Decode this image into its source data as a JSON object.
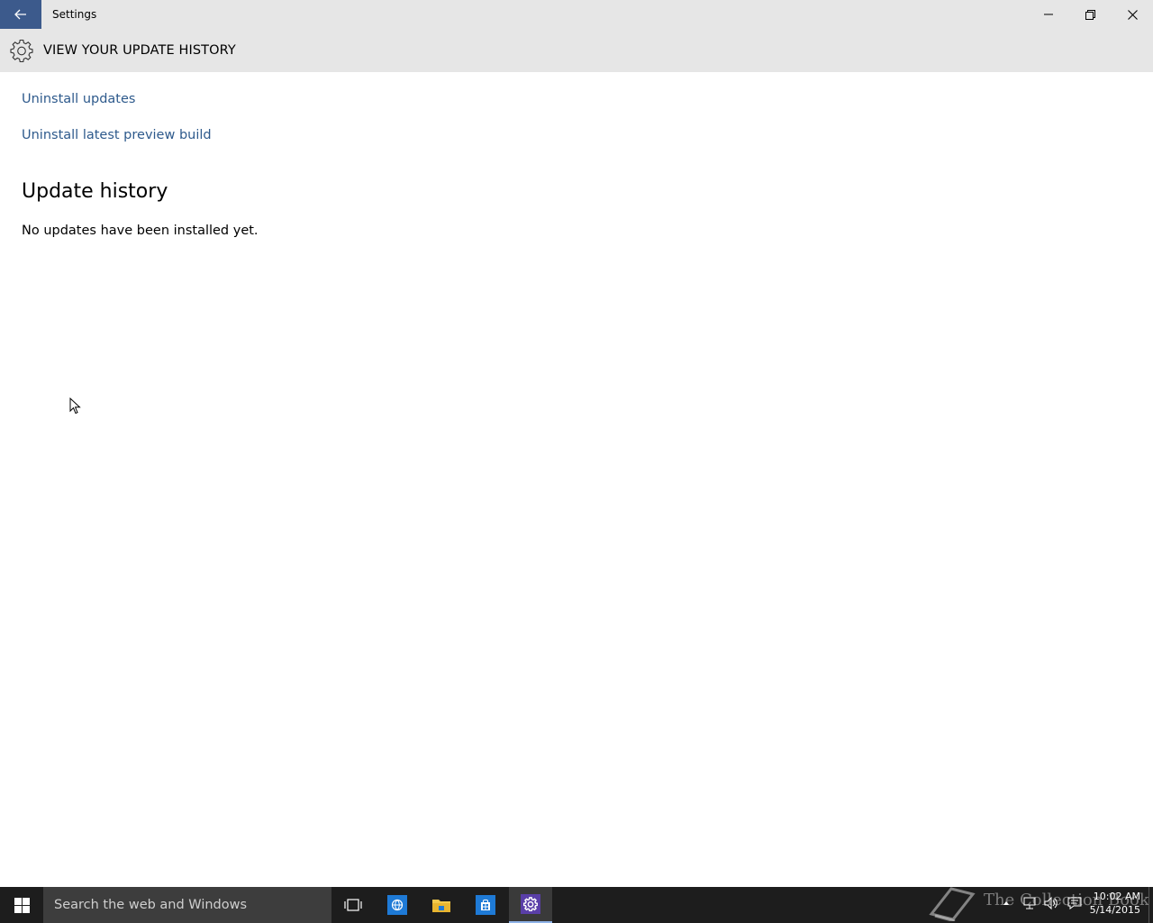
{
  "window": {
    "title": "Settings",
    "controls": {
      "minimize": "minimize-icon",
      "restore": "restore-icon",
      "close": "close-icon"
    }
  },
  "header": {
    "title": "VIEW YOUR UPDATE HISTORY",
    "icon": "gear-icon"
  },
  "content": {
    "links": [
      {
        "label": "Uninstall updates"
      },
      {
        "label": "Uninstall latest preview build"
      }
    ],
    "section_heading": "Update history",
    "section_body": "No updates have been installed yet."
  },
  "taskbar": {
    "search_placeholder": "Search the web and Windows",
    "apps": [
      "task-view-icon",
      "edge-browser-icon",
      "file-explorer-icon",
      "store-icon",
      "settings-icon"
    ],
    "tray": [
      "chevron-up-icon",
      "network-icon",
      "volume-icon",
      "action-center-icon"
    ],
    "clock_time": "10:02 AM",
    "clock_date": "5/14/2015"
  },
  "watermark": {
    "text": "The Collection Book"
  },
  "colors": {
    "accent": "#3c5a8c",
    "link": "#2e5a8c",
    "chrome": "#e6e6e6",
    "taskbar": "#1d1d1d"
  }
}
